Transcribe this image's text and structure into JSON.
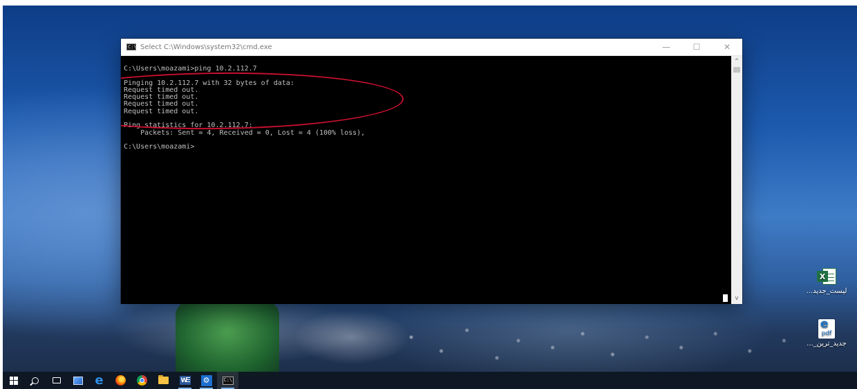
{
  "window": {
    "title": "Select C:\\Windows\\system32\\cmd.exe",
    "icon_label": "C:\\",
    "minimize_glyph": "—",
    "maximize_glyph": "☐",
    "close_glyph": "✕"
  },
  "console": {
    "lines": [
      "C:\\Users\\moazami>ping 10.2.112.7",
      "",
      "Pinging 10.2.112.7 with 32 bytes of data:",
      "Request timed out.",
      "Request timed out.",
      "Request timed out.",
      "Request timed out.",
      "",
      "Ping statistics for 10.2.112.7:",
      "    Packets: Sent = 4, Received = 0, Lost = 4 (100% loss),",
      "",
      "C:\\Users\\moazami>"
    ]
  },
  "scrollbar": {
    "up_glyph": "^",
    "down_glyph": "v"
  },
  "desktop_icons": {
    "excel": {
      "label": "لیست_جدید...",
      "icon": "excel-file-icon",
      "badge": "X"
    },
    "pdf": {
      "label": "جدید_ترین_...",
      "icon": "pdf-file-icon",
      "badge": "e",
      "badge_text": "pdf"
    }
  },
  "taskbar": {
    "items": [
      {
        "name": "start-button",
        "icon": "windows-logo-icon"
      },
      {
        "name": "search-button",
        "icon": "search-icon"
      },
      {
        "name": "task-view-button",
        "icon": "task-view-icon"
      },
      {
        "name": "show-desktop-button",
        "icon": "desktop-icon"
      },
      {
        "name": "edge-button",
        "icon": "edge-icon",
        "glyph": "e"
      },
      {
        "name": "firefox-button",
        "icon": "firefox-icon"
      },
      {
        "name": "chrome-button",
        "icon": "chrome-icon"
      },
      {
        "name": "file-explorer-button",
        "icon": "folder-icon"
      },
      {
        "name": "word-button",
        "icon": "word-icon",
        "glyph": "W"
      },
      {
        "name": "settings-button",
        "icon": "gear-icon",
        "glyph": "⚙"
      },
      {
        "name": "cmd-button",
        "icon": "cmd-icon",
        "glyph": "C:\\"
      }
    ]
  },
  "colors": {
    "annotation": "#c8102e",
    "console_bg": "#000000",
    "console_fg": "#c0c0c0",
    "taskbar_bg": "#0e1622"
  }
}
